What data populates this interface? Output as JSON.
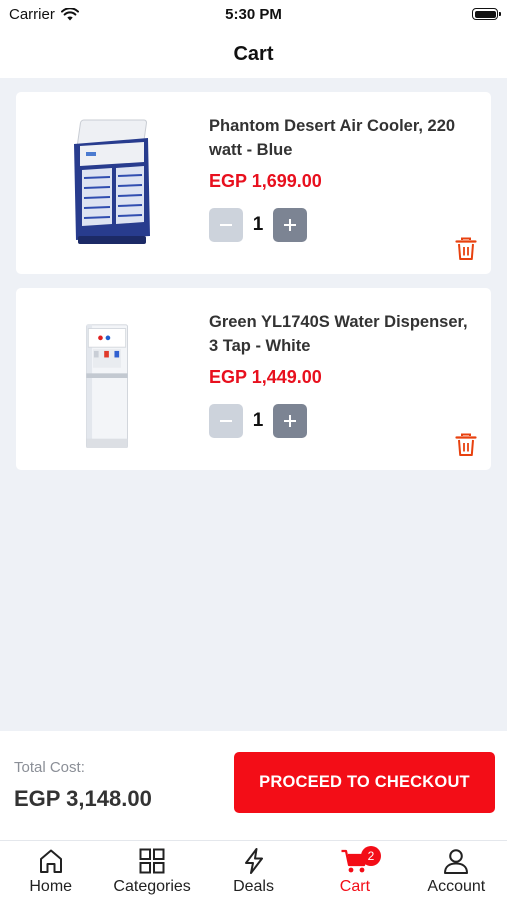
{
  "status_bar": {
    "carrier": "Carrier",
    "time": "5:30 PM"
  },
  "header": {
    "title": "Cart"
  },
  "cart": {
    "items": [
      {
        "name": "Phantom Desert Air Cooler, 220 watt - Blue",
        "price": "EGP 1,699.00",
        "quantity": "1"
      },
      {
        "name": "Green YL1740S Water Dispenser, 3 Tap - White",
        "price": "EGP 1,449.00",
        "quantity": "1"
      }
    ]
  },
  "footer": {
    "total_label": "Total Cost:",
    "total_value": "EGP 3,148.00",
    "checkout_label": "PROCEED TO CHECKOUT"
  },
  "tabs": [
    {
      "label": "Home",
      "icon": "home-icon"
    },
    {
      "label": "Categories",
      "icon": "grid-icon"
    },
    {
      "label": "Deals",
      "icon": "lightning-icon"
    },
    {
      "label": "Cart",
      "icon": "cart-icon",
      "badge": "2",
      "active": true
    },
    {
      "label": "Account",
      "icon": "person-icon"
    }
  ],
  "colors": {
    "accent": "#f30d17",
    "price": "#e8101e",
    "background": "#eef1f6"
  }
}
